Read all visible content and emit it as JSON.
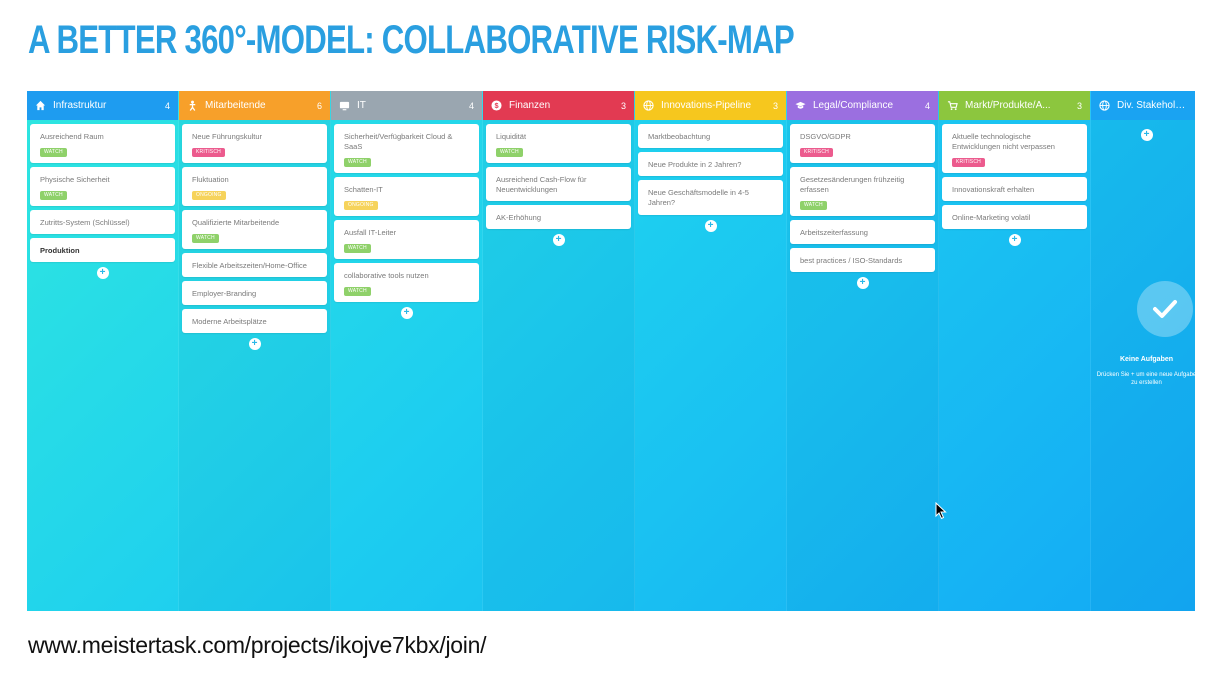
{
  "slide": {
    "title": "A BETTER 360°-MODEL: COLLABORATIVE RISK-MAP",
    "url": "www.meistertask.com/projects/ikojve7kbx/join/"
  },
  "colors": {
    "title": "#2a9fe0",
    "tag_watch": "#8fd16a",
    "tag_kritisch": "#ec5b8e",
    "tag_ongoing": "#f6d35b"
  },
  "columns": [
    {
      "name": "Infrastruktur",
      "count": "4",
      "icon": "home-icon",
      "color": "#1e9cf0",
      "cards": [
        {
          "title": "Ausreichend Raum",
          "tag": "watch"
        },
        {
          "title": "Physische Sicherheit",
          "tag": "watch"
        },
        {
          "title": "Zutritts-System (Schlüssel)",
          "tag": ""
        },
        {
          "title": "Produktion",
          "tag": "",
          "bold": true
        }
      ]
    },
    {
      "name": "Mitarbeitende",
      "count": "6",
      "icon": "person-icon",
      "color": "#f7a02a",
      "cards": [
        {
          "title": "Neue Führungskultur",
          "tag": "KRITISCH"
        },
        {
          "title": "Fluktuation",
          "tag": "ongoing"
        },
        {
          "title": "Qualifizierte Mitarbeitende",
          "tag": "watch"
        },
        {
          "title": "Flexible Arbeitszeiten/Home-Office",
          "tag": ""
        },
        {
          "title": "Employer-Branding",
          "tag": ""
        },
        {
          "title": "Moderne Arbeitsplätze",
          "tag": ""
        }
      ]
    },
    {
      "name": "IT",
      "count": "4",
      "icon": "monitor-icon",
      "color": "#9aa6b0",
      "cards": [
        {
          "title": "Sicherheit/Verfügbarkeit Cloud & SaaS",
          "tag": "watch"
        },
        {
          "title": "Schatten-IT",
          "tag": "ongoing"
        },
        {
          "title": "Ausfall IT-Leiter",
          "tag": "watch"
        },
        {
          "title": "collaborative tools nutzen",
          "tag": "watch"
        }
      ]
    },
    {
      "name": "Finanzen",
      "count": "3",
      "icon": "dollar-icon",
      "color": "#e23a52",
      "cards": [
        {
          "title": "Liquidität",
          "tag": "watch"
        },
        {
          "title": "Ausreichend Cash-Flow für Neuentwicklungen",
          "tag": ""
        },
        {
          "title": "AK-Erhöhung",
          "tag": ""
        }
      ]
    },
    {
      "name": "Innovations-Pipeline",
      "count": "3",
      "icon": "globe-icon",
      "color": "#f6c71e",
      "cards": [
        {
          "title": "Marktbeobachtung",
          "tag": ""
        },
        {
          "title": "Neue Produkte in 2 Jahren?",
          "tag": ""
        },
        {
          "title": "Neue Geschäftsmodelle in 4-5 Jahren?",
          "tag": ""
        }
      ]
    },
    {
      "name": "Legal/Compliance",
      "count": "4",
      "icon": "graduation-cap-icon",
      "color": "#9b6fe0",
      "cards": [
        {
          "title": "DSGVO/GDPR",
          "tag": "KRITISCH"
        },
        {
          "title": "Gesetzesänderungen frühzeitig erfassen",
          "tag": "watch"
        },
        {
          "title": "Arbeitszeiterfassung",
          "tag": ""
        },
        {
          "title": "best practices / ISO-Standards",
          "tag": ""
        }
      ]
    },
    {
      "name": "Markt/Produkte/A...",
      "count": "3",
      "icon": "cart-icon",
      "color": "#8cc63e",
      "cards": [
        {
          "title": "Aktuelle technologische Entwicklungen nicht verpassen",
          "tag": "KRITISCH"
        },
        {
          "title": "Innovationskraft erhalten",
          "tag": ""
        },
        {
          "title": "Online-Marketing volatil",
          "tag": ""
        }
      ]
    },
    {
      "name": "Div. Stakeholders",
      "count": "",
      "icon": "globe-icon",
      "color": "#1aa3f2",
      "cards": [],
      "empty": {
        "title": "Keine Aufgaben",
        "subtitle": "Drücken Sie + um eine neue Aufgabe zu erstellen"
      }
    }
  ],
  "add_label": "+"
}
